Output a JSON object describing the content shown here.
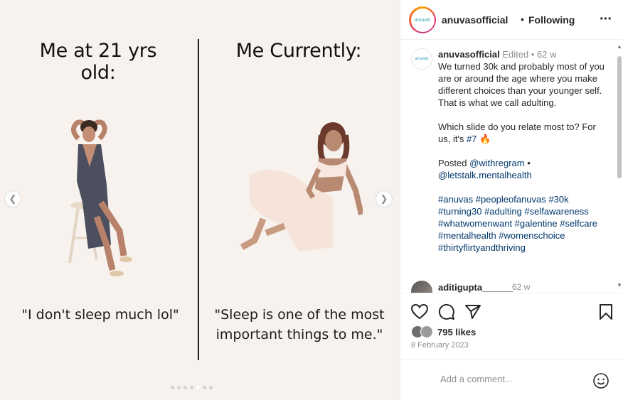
{
  "media": {
    "left_title": "Me at 21 yrs old:",
    "right_title": "Me Currently:",
    "left_caption": "\"I don't sleep much lol\"",
    "right_caption": "\"Sleep is one of the most important things to me.\"",
    "slide_count": 7,
    "active_slide": 5
  },
  "header": {
    "avatar_text": "anuvas",
    "username": "anuvasofficial",
    "separator": "•",
    "follow_status": "Following"
  },
  "post": {
    "avatar_text": "anuvas",
    "username": "anuvasofficial",
    "edited": "Edited",
    "dot": "•",
    "time": "62 w",
    "caption_line1": "We turned 30k and probably most of you are or around the age where you make different choices than your younger self.",
    "caption_line2": "That is what we call adulting.",
    "question": "Which slide do you relate most to? For us, it's ",
    "hashtag_seven": "#7",
    "fire_emoji": "🔥",
    "posted_label": "Posted ",
    "credit_1": "@withregram",
    "credit_sep": " •",
    "credit_2": "@letstalk.mentalhealth",
    "hashtags": "#anuvas #peopleofanuvas #30k #turning30 #adulting #selfawareness #whatwomenwant #galentine #selfcare #mentalhealth #womenschoice #thirtyflirtyandthriving"
  },
  "comments": [
    {
      "username": "aditigupta______",
      "time": "62 w"
    }
  ],
  "stats": {
    "likes": "795 likes",
    "date": "8 February 2023"
  },
  "comment_box": {
    "placeholder": "Add a comment..."
  },
  "colors": {
    "media_bg": "#f7f2ee",
    "link": "#00376b",
    "meta": "#8e8e8e"
  }
}
